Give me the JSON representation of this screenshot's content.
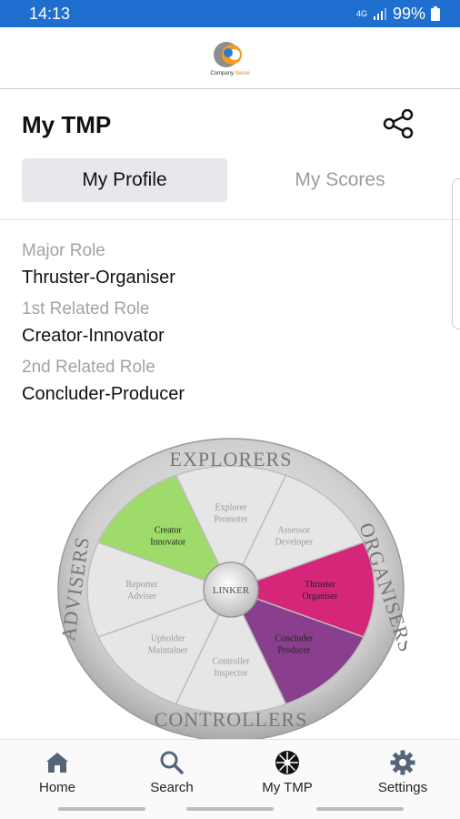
{
  "status": {
    "time": "14:13",
    "network": "4G",
    "battery": "99%"
  },
  "header": {
    "logo_text_a": "Company",
    "logo_text_b": "Name"
  },
  "page": {
    "title": "My TMP"
  },
  "tabs": [
    {
      "label": "My Profile"
    },
    {
      "label": "My Scores"
    }
  ],
  "roles": [
    {
      "label": "Major Role",
      "value": "Thruster-Organiser"
    },
    {
      "label": "1st Related Role",
      "value": "Creator-Innovator"
    },
    {
      "label": "2nd Related Role",
      "value": "Concluder-Producer"
    }
  ],
  "wheel": {
    "center": "LINKER",
    "outer": [
      "EXPLORERS",
      "ORGANISERS",
      "CONTROLLERS",
      "ADVISERS"
    ],
    "segments": [
      {
        "line1": "Explorer",
        "line2": "Promoter"
      },
      {
        "line1": "Assessor",
        "line2": "Developer"
      },
      {
        "line1": "Thruster",
        "line2": "Organiser"
      },
      {
        "line1": "Concluder",
        "line2": "Producer"
      },
      {
        "line1": "Controller",
        "line2": "Inspector"
      },
      {
        "line1": "Upholder",
        "line2": "Maintainer"
      },
      {
        "line1": "Reporter",
        "line2": "Adviser"
      },
      {
        "line1": "Creator",
        "line2": "Innovator"
      }
    ],
    "colors": {
      "major": "#d6267a",
      "related_1": "#9fdb6a",
      "related_2": "#8a3e8e",
      "neutral": "#e6e6e6"
    }
  },
  "nav": [
    {
      "label": "Home",
      "icon": "home-icon"
    },
    {
      "label": "Search",
      "icon": "search-icon"
    },
    {
      "label": "My TMP",
      "icon": "wheel-icon"
    },
    {
      "label": "Settings",
      "icon": "gear-icon"
    }
  ],
  "accent": "#1e6fd0"
}
